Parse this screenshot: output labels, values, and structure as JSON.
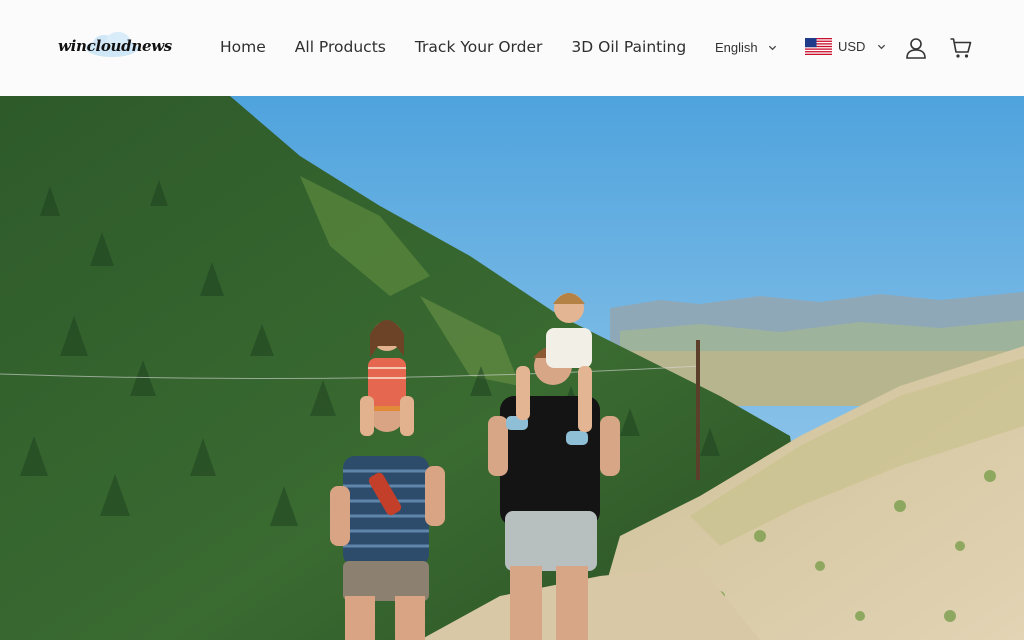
{
  "brand": {
    "name": "wincloudnews"
  },
  "nav": [
    {
      "label": "Home"
    },
    {
      "label": "All Products"
    },
    {
      "label": "Track Your Order"
    },
    {
      "label": "3D Oil Painting"
    }
  ],
  "language": {
    "selected": "English"
  },
  "currency": {
    "selected": "USD",
    "flag": "us-flag-icon"
  },
  "icons": {
    "account": "account-icon",
    "cart": "cart-icon"
  },
  "colors": {
    "header_bg": "#fbfbfb",
    "nav_text": "#2f2f2f",
    "sky": "#5ba8e0"
  }
}
